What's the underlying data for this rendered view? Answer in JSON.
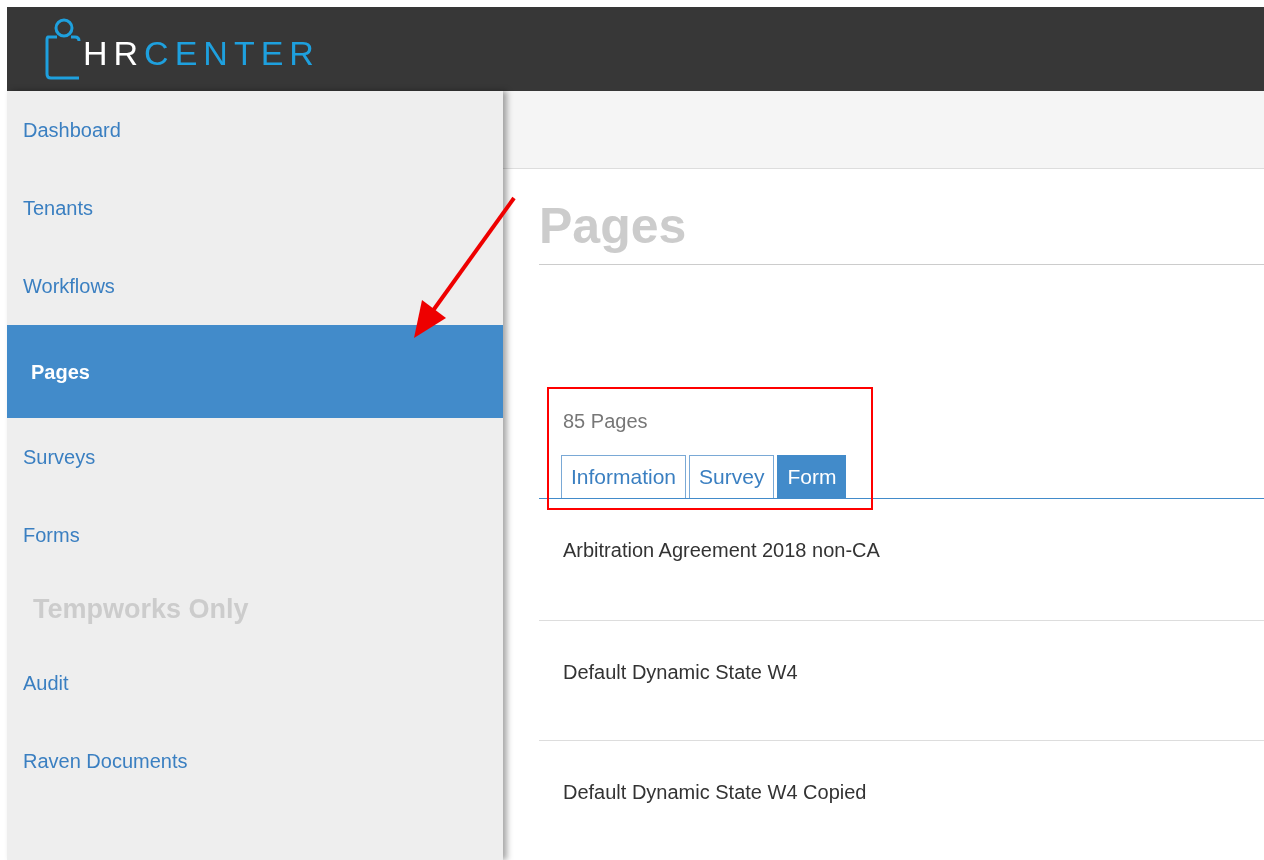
{
  "brand": {
    "first": "HR",
    "second": "CENTER"
  },
  "sidebar": {
    "items": [
      {
        "kind": "link",
        "label": "Dashboard",
        "selected": false
      },
      {
        "kind": "link",
        "label": "Tenants",
        "selected": false
      },
      {
        "kind": "link",
        "label": "Workflows",
        "selected": false
      },
      {
        "kind": "link",
        "label": "Pages",
        "selected": true
      },
      {
        "kind": "link",
        "label": "Surveys",
        "selected": false
      },
      {
        "kind": "link",
        "label": "Forms",
        "selected": false
      },
      {
        "kind": "heading",
        "label": "Tempworks Only"
      },
      {
        "kind": "link",
        "label": "Audit",
        "selected": false
      },
      {
        "kind": "link",
        "label": "Raven Documents",
        "selected": false
      }
    ]
  },
  "page_title": "Pages",
  "count": "85 Pages",
  "tabs": [
    {
      "label": "Information",
      "selected": false
    },
    {
      "label": "Survey",
      "selected": false
    },
    {
      "label": "Form",
      "selected": true
    }
  ],
  "rows": [
    {
      "title": "Arbitration Agreement 2018 non-CA"
    },
    {
      "title": "Default Dynamic State W4"
    },
    {
      "title": "Default Dynamic State W4 Copied"
    }
  ],
  "annotations": {
    "arrow": true,
    "highlight_box": true
  }
}
